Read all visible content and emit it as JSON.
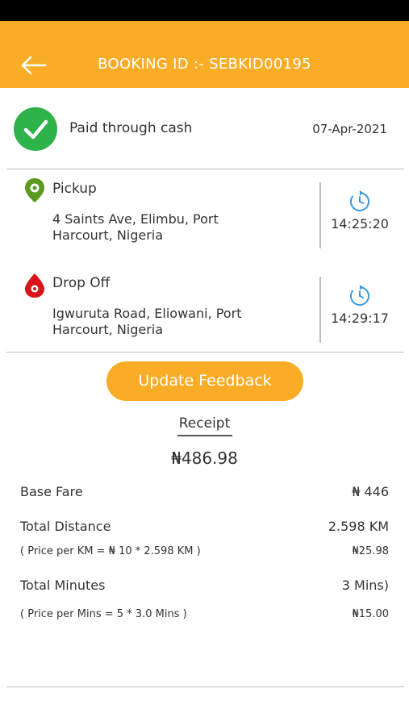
{
  "header": {
    "title": "BOOKING ID :- SEBKID00195",
    "back_icon": "arrow-left-icon"
  },
  "payment": {
    "status_icon": "check-circle-icon",
    "label": "Paid through cash",
    "date": "07-Apr-2021"
  },
  "pickup": {
    "label": "Pickup",
    "address_line1": "4 Saints Ave, Elimbu, Port",
    "address_line2": "Harcourt, Nigeria",
    "time": "14:25:20",
    "icon": "pickup-pin-icon",
    "color": "#5A9A1E"
  },
  "dropoff": {
    "label": "Drop Off",
    "address_line1": "Igwuruta Road, Eliowani, Port",
    "address_line2": "Harcourt, Nigeria",
    "time": "14:29:17",
    "icon": "dropoff-pin-icon",
    "color": "#D8141A"
  },
  "feedback_button": "Update Feedback",
  "receipt": {
    "label": "Receipt",
    "total": "₦486.98",
    "base_fare_label": "Base Fare",
    "base_fare_value": "₦ 446",
    "distance_label": "Total Distance",
    "distance_value": "2.598 KM",
    "distance_formula": "( Price per KM =  ₦ 10 * 2.598 KM )",
    "distance_amount": "₦25.98",
    "minutes_label": "Total Minutes",
    "minutes_value": "3 Mins)",
    "minutes_formula": "( Price per Mins = 5 * 3.0 Mins )",
    "minutes_amount": "₦15.00"
  },
  "colors": {
    "accent": "#F9AD26",
    "success": "#2DB34A",
    "clock": "#3B9BE0"
  }
}
